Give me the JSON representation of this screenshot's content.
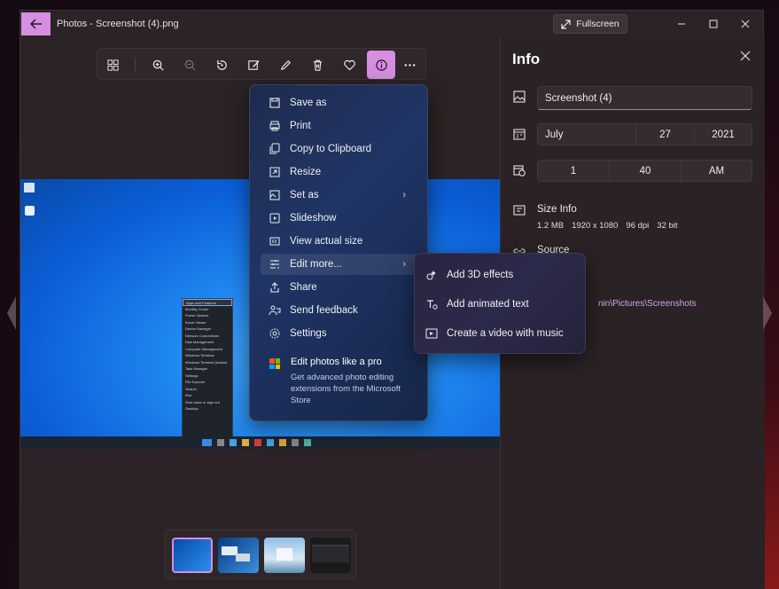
{
  "window": {
    "title": "Photos - Screenshot (4).png",
    "back_icon": "arrow-left-icon",
    "fullscreen_label": "Fullscreen"
  },
  "toolbar": {
    "icons": [
      "crop-icon",
      "zoom-in-icon",
      "zoom-out-icon",
      "rotate-icon",
      "edit-image-icon",
      "draw-icon",
      "delete-icon",
      "favorite-icon",
      "info-icon",
      "more-icon"
    ]
  },
  "context_menu": {
    "items": [
      {
        "label": "Save as",
        "icon": "save-icon"
      },
      {
        "label": "Print",
        "icon": "print-icon"
      },
      {
        "label": "Copy to Clipboard",
        "icon": "copy-icon"
      },
      {
        "label": "Resize",
        "icon": "resize-icon"
      },
      {
        "label": "Set as",
        "icon": "set-as-icon",
        "submenu": true
      },
      {
        "label": "Slideshow",
        "icon": "slideshow-icon"
      },
      {
        "label": "View actual size",
        "icon": "actual-size-icon"
      },
      {
        "label": "Edit more...",
        "icon": "edit-more-icon",
        "submenu": true
      },
      {
        "label": "Share",
        "icon": "share-icon"
      },
      {
        "label": "Send feedback",
        "icon": "feedback-icon"
      },
      {
        "label": "Settings",
        "icon": "settings-icon"
      }
    ],
    "promo": {
      "title": "Edit photos like a pro",
      "body": "Get advanced photo editing extensions from the Microsoft Store"
    }
  },
  "submenu": {
    "items": [
      {
        "label": "Add 3D effects",
        "icon": "3d-effects-icon"
      },
      {
        "label": "Add animated text",
        "icon": "animated-text-icon"
      },
      {
        "label": "Create a video with music",
        "icon": "video-icon"
      }
    ]
  },
  "info": {
    "title": "Info",
    "file_name": "Screenshot (4)",
    "date": {
      "month": "July",
      "day": "27",
      "year": "2021"
    },
    "time": {
      "hour": "1",
      "minute": "40",
      "ampm": "AM"
    },
    "size_info_label": "Size Info",
    "size_details": [
      "1.2 MB",
      "1920 x 1080",
      "96 dpi",
      "32 bit"
    ],
    "source_label": "Source",
    "source_path": "nin\\Pictures\\Screenshots"
  },
  "startmenu_items": [
    "Apps and Features",
    "Mobility Center",
    "Power Options",
    "Event Viewer",
    "Device Manager",
    "Network Connections",
    "Disk Management",
    "Computer Management",
    "Windows Terminal",
    "Windows Terminal (Admin)",
    "Task Manager",
    "Settings",
    "File Explorer",
    "Search",
    "Run",
    "Shut down or sign out",
    "Desktop"
  ]
}
